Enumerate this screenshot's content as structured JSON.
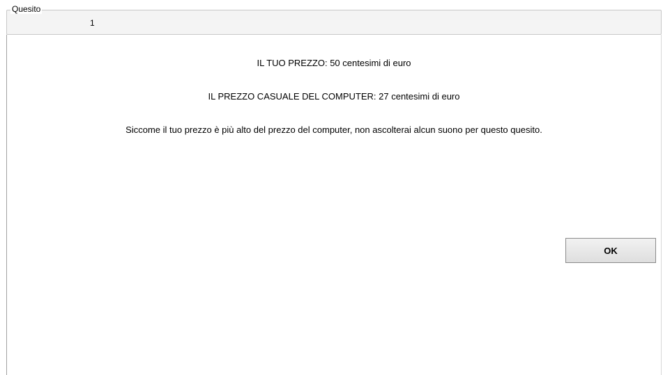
{
  "group": {
    "legend": "Quesito",
    "value": "1"
  },
  "content": {
    "your_price": "IL TUO PREZZO: 50 centesimi di euro",
    "computer_price": "IL PREZZO CASUALE DEL COMPUTER: 27 centesimi di euro",
    "message": "Siccome il tuo prezzo è più alto del prezzo del computer, non ascolterai alcun suono per questo quesito."
  },
  "buttons": {
    "ok_label": "OK"
  }
}
